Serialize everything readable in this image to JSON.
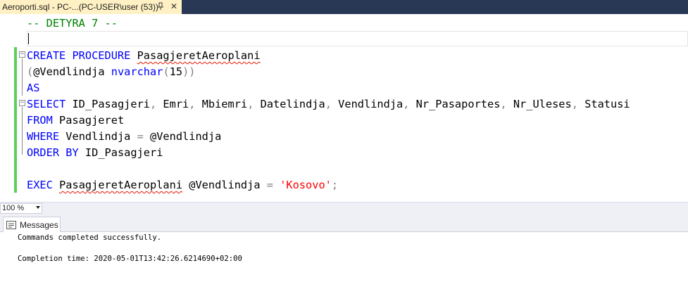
{
  "tab": {
    "title": "Aeroporti.sql - PC-...(PC-USER\\user (53))",
    "pin_icon": "pin-icon",
    "close_icon": "close-icon",
    "close_glyph": "✕"
  },
  "editor": {
    "lines": [
      [
        {
          "t": "-- DETYRA 7 --",
          "c": "cm"
        }
      ],
      [],
      [
        {
          "t": "CREATE PROCEDURE",
          "c": "kw"
        },
        {
          "t": " "
        },
        {
          "t": "PasagjeretAeroplani",
          "c": "sq"
        }
      ],
      [
        {
          "t": "(",
          "c": "gr"
        },
        {
          "t": "@Vendlindja"
        },
        {
          "t": " "
        },
        {
          "t": "nvarchar",
          "c": "kw"
        },
        {
          "t": "(",
          "c": "gr"
        },
        {
          "t": "15"
        },
        {
          "t": "))",
          "c": "gr"
        }
      ],
      [
        {
          "t": "AS",
          "c": "kw"
        }
      ],
      [
        {
          "t": "SELECT",
          "c": "kw"
        },
        {
          "t": " ID_Pasagjeri"
        },
        {
          "t": ",",
          "c": "gr"
        },
        {
          "t": " Emri"
        },
        {
          "t": ",",
          "c": "gr"
        },
        {
          "t": " Mbiemri"
        },
        {
          "t": ",",
          "c": "gr"
        },
        {
          "t": " Datelindja"
        },
        {
          "t": ",",
          "c": "gr"
        },
        {
          "t": " Vendlindja"
        },
        {
          "t": ",",
          "c": "gr"
        },
        {
          "t": " Nr_Pasaportes"
        },
        {
          "t": ",",
          "c": "gr"
        },
        {
          "t": " Nr_Uleses"
        },
        {
          "t": ",",
          "c": "gr"
        },
        {
          "t": " Statusi"
        }
      ],
      [
        {
          "t": "FROM",
          "c": "kw"
        },
        {
          "t": " Pasagjeret"
        }
      ],
      [
        {
          "t": "WHERE",
          "c": "kw"
        },
        {
          "t": " Vendlindja "
        },
        {
          "t": "=",
          "c": "gr"
        },
        {
          "t": " @Vendlindja"
        }
      ],
      [
        {
          "t": "ORDER BY",
          "c": "kw"
        },
        {
          "t": " ID_Pasagjeri"
        }
      ],
      [],
      [
        {
          "t": "EXEC",
          "c": "kw"
        },
        {
          "t": " "
        },
        {
          "t": "PasagjeretAeroplani",
          "c": "sq"
        },
        {
          "t": " @Vendlindja "
        },
        {
          "t": "=",
          "c": "gr"
        },
        {
          "t": " "
        },
        {
          "t": "'Kosovo'",
          "c": "st"
        },
        {
          "t": ";",
          "c": "gr"
        }
      ]
    ],
    "fold_glyph": "−"
  },
  "zoom": {
    "value": "100 %"
  },
  "messages": {
    "tab_label": "Messages",
    "line1": "Commands completed successfully.",
    "line2": "Completion time: 2020-05-01T13:42:26.6214690+02:00"
  },
  "colors": {
    "keyword": "#0000ff",
    "comment": "#008000",
    "string": "#ff0000",
    "function": "#ff00ff",
    "operator": "#808080",
    "change_bar": "#5ccf5c"
  }
}
